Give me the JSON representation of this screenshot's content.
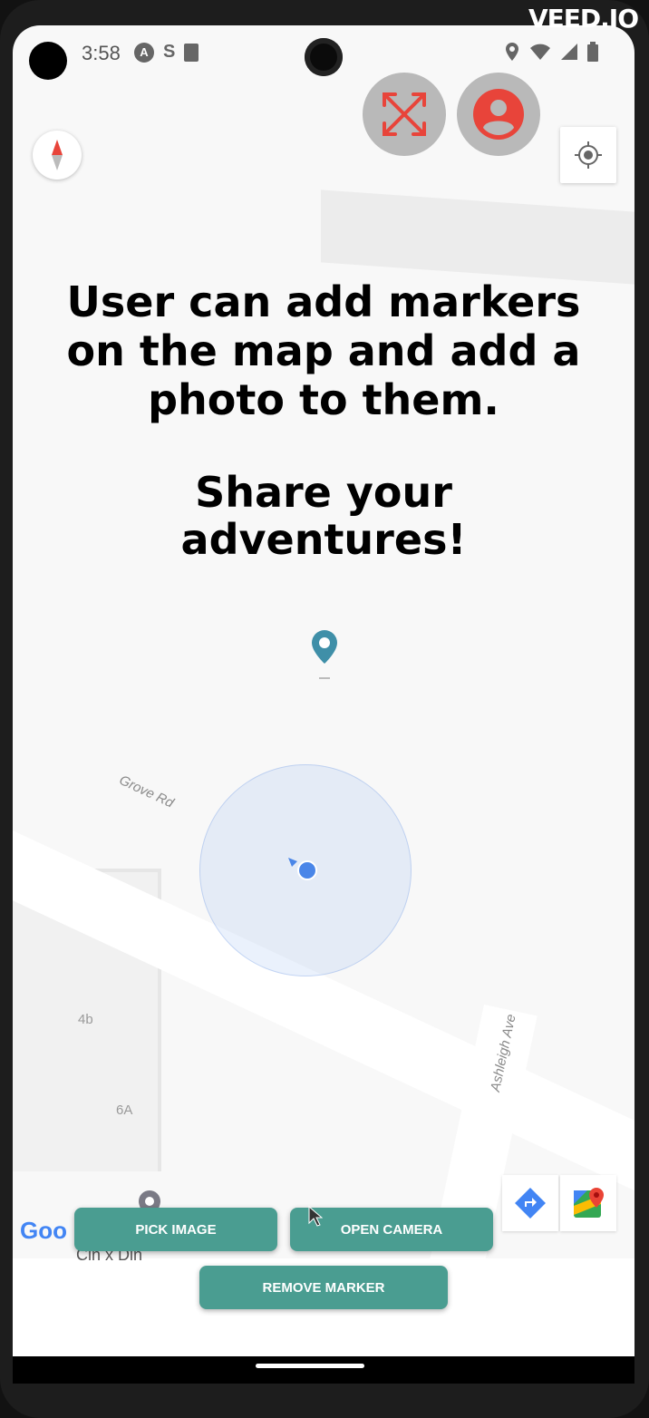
{
  "watermark": "VEED.IO",
  "status_bar": {
    "time": "3:58",
    "icons": [
      "a-icon",
      "s-icon",
      "sdcard-icon",
      "location-icon",
      "wifi-icon",
      "signal-icon",
      "battery-icon"
    ]
  },
  "overlay": {
    "line1": "User can add markers",
    "line2": "on the map and add a",
    "line3": "photo to them.",
    "line4": "Share your",
    "line5": "adventures!"
  },
  "map": {
    "road_label_1": "Grove Rd",
    "road_label_2": "Ashleigh Ave",
    "building_label_1": "4b",
    "building_label_2": "6A",
    "poi_partial": "Cin x Din",
    "google_logo": "Goo"
  },
  "buttons": {
    "pick_image": "PICK IMAGE",
    "open_camera": "OPEN CAMERA",
    "remove_marker": "REMOVE MARKER"
  },
  "colors": {
    "accent": "#4a9d91",
    "fab_icon": "#e8443a",
    "marker": "#3f8fa8",
    "location_dot": "#4a86e8"
  }
}
